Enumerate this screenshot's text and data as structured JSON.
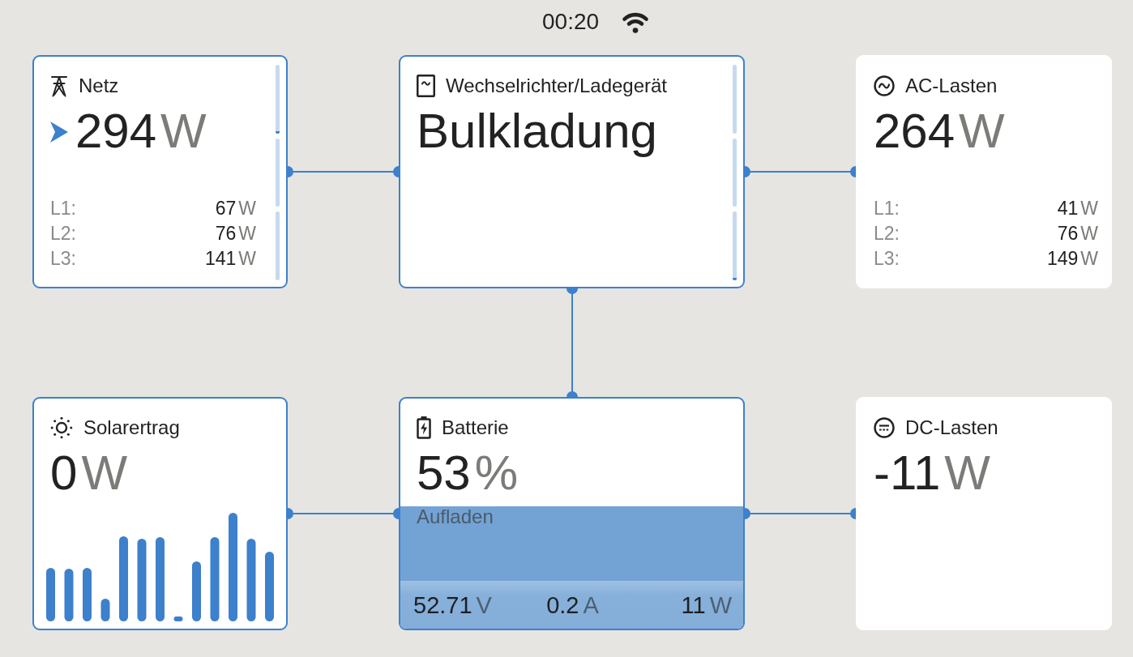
{
  "status_bar": {
    "time": "00:20"
  },
  "cards": [
    {
      "kind": "grid",
      "title": "Netz",
      "outlined": true,
      "flow_arrow": true,
      "value": "294",
      "unit": "W",
      "phases": [
        {
          "label": "L1:",
          "value": "67",
          "unit": "W"
        },
        {
          "label": "L2:",
          "value": "76",
          "unit": "W"
        },
        {
          "label": "L3:",
          "value": "141",
          "unit": "W"
        }
      ],
      "meters": [
        {
          "level": 0.03
        },
        {
          "level": 0
        },
        {
          "level": 0
        }
      ]
    },
    {
      "kind": "inverter",
      "title": "Wechselrichter/Ladegerät",
      "outlined": true,
      "state_text": "Bulkladung",
      "meters": [
        {
          "level": 0
        },
        {
          "level": 0
        },
        {
          "level": 0.04
        }
      ]
    },
    {
      "kind": "ac_loads",
      "title": "AC-Lasten",
      "outlined": false,
      "value": "264",
      "unit": "W",
      "phases": [
        {
          "label": "L1:",
          "value": "41",
          "unit": "W"
        },
        {
          "label": "L2:",
          "value": "76",
          "unit": "W"
        },
        {
          "label": "L3:",
          "value": "149",
          "unit": "W"
        }
      ]
    },
    {
      "kind": "solar",
      "title": "Solarertrag",
      "outlined": true,
      "value": "0",
      "unit": "W"
    },
    {
      "kind": "battery",
      "title": "Batterie",
      "outlined": true,
      "value": "53",
      "unit": "%",
      "state_text": "Aufladen",
      "readings": [
        {
          "value": "52.71",
          "unit": "V"
        },
        {
          "value": "0.2",
          "unit": "A"
        },
        {
          "value": "11",
          "unit": "W"
        }
      ]
    },
    {
      "kind": "dc_loads",
      "title": "DC-Lasten",
      "outlined": false,
      "value": "-11",
      "unit": "W"
    }
  ]
}
